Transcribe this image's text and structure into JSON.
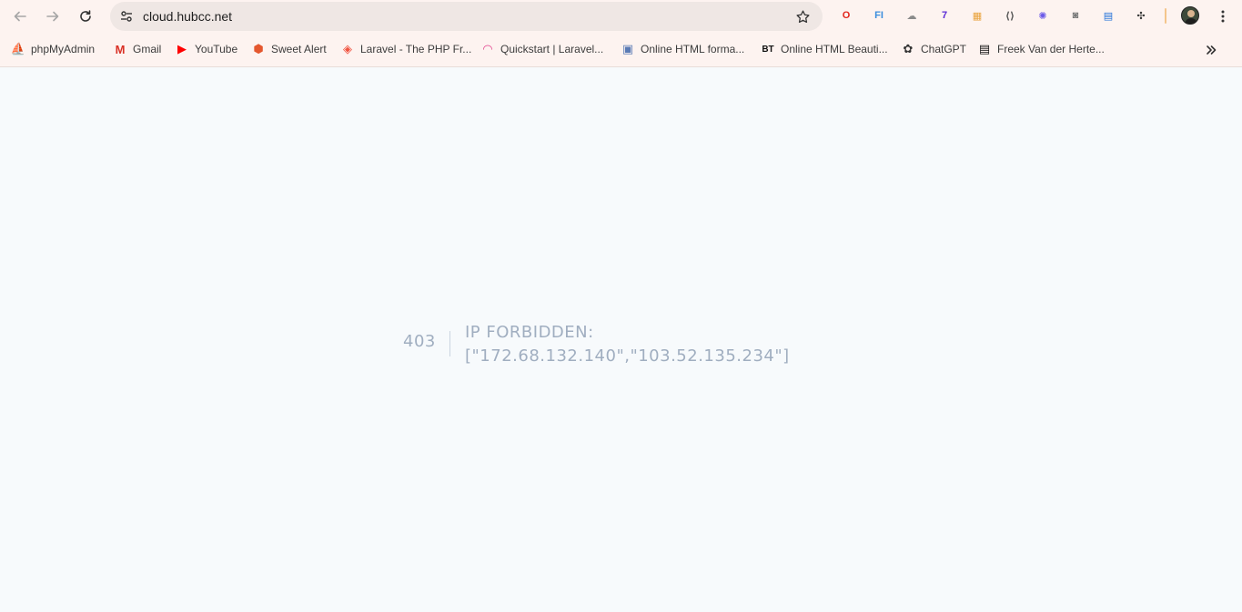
{
  "browser": {
    "url": "cloud.hubcc.net",
    "extensions": [
      {
        "name": "opera-icon",
        "glyph": "O",
        "color": "#e2261c"
      },
      {
        "name": "fi-icon",
        "glyph": "FI",
        "color": "#3b8ede"
      },
      {
        "name": "cloud-icon",
        "glyph": "☁",
        "color": "#8a8a8a"
      },
      {
        "name": "stack-icon",
        "glyph": "7",
        "color": "#5b2bd6"
      },
      {
        "name": "colorful-icon",
        "glyph": "▦",
        "color": "#e9a23b"
      },
      {
        "name": "code-icon",
        "glyph": "⟨⟩",
        "color": "#555555"
      },
      {
        "name": "spark-icon",
        "glyph": "✺",
        "color": "#6b5ae8"
      },
      {
        "name": "camera-icon",
        "glyph": "◙",
        "color": "#777777"
      },
      {
        "name": "screen-icon",
        "glyph": "▤",
        "color": "#1e6fd9"
      },
      {
        "name": "puzzle-icon",
        "glyph": "✣",
        "color": "#333333"
      }
    ]
  },
  "bookmarks": [
    {
      "name": "bookmark-phpmyadmin",
      "label": "phpMyAdmin",
      "icon": "phpmyadmin-icon",
      "glyph": "⛵",
      "color": "#f29111"
    },
    {
      "name": "bookmark-gmail",
      "label": "Gmail",
      "icon": "gmail-icon",
      "glyph": "M",
      "color": "#d93025"
    },
    {
      "name": "bookmark-youtube",
      "label": "YouTube",
      "icon": "youtube-icon",
      "glyph": "▶",
      "color": "#ff0000"
    },
    {
      "name": "bookmark-sweet-alert",
      "label": "Sweet Alert",
      "icon": "shield-icon",
      "glyph": "⬢",
      "color": "#e4572e"
    },
    {
      "name": "bookmark-laravel",
      "label": "Laravel - The PHP Fr...",
      "icon": "laravel-icon",
      "glyph": "◈",
      "color": "#f05340"
    },
    {
      "name": "bookmark-quickstart",
      "label": "Quickstart | Laravel...",
      "icon": "quickstart-icon",
      "glyph": "◠",
      "color": "#e23e8b"
    },
    {
      "name": "bookmark-html-formatter",
      "label": "Online HTML forma...",
      "icon": "code-window-icon",
      "glyph": "▣",
      "color": "#5a7bb5"
    },
    {
      "name": "bookmark-html-beautifier",
      "label": "Online HTML Beauti...",
      "icon": "bt-icon",
      "glyph": "BT",
      "color": "#111111"
    },
    {
      "name": "bookmark-chatgpt",
      "label": "ChatGPT",
      "icon": "chatgpt-icon",
      "glyph": "✿",
      "color": "#333333"
    },
    {
      "name": "bookmark-freek",
      "label": "Freek Van der Herte...",
      "icon": "blog-icon",
      "glyph": "▤",
      "color": "#111111"
    }
  ],
  "error": {
    "code": "403",
    "message_line1": "IP FORBIDDEN:",
    "message_line2": "[\"172.68.132.140\",\"103.52.135.234\"]"
  }
}
